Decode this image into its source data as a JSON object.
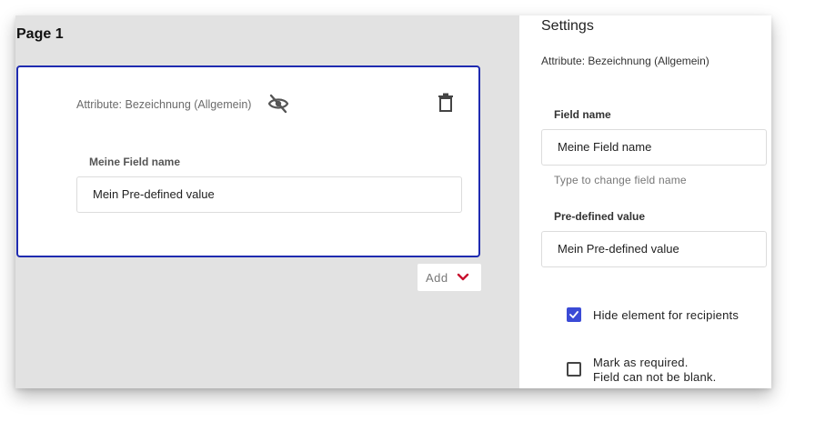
{
  "canvas": {
    "page_title": "Page 1",
    "card": {
      "attribute_label": "Attribute: Bezeichnung (Allgemein)",
      "field_label": "Meine Field name",
      "field_value": "Mein Pre-defined value",
      "hidden_icon": "eye-off-icon",
      "delete_icon": "trash-icon"
    },
    "add_button": {
      "label": "Add",
      "icon": "chevron-down-icon"
    }
  },
  "settings": {
    "title": "Settings",
    "attribute": "Attribute: Bezeichnung (Allgemein)",
    "field_name": {
      "label": "Field name",
      "value": "Meine Field name",
      "hint": "Type to change field name"
    },
    "predefined_value": {
      "label": "Pre-defined value",
      "value": "Mein Pre-defined value"
    },
    "options": [
      {
        "label_line1": "Hide element for recipients",
        "label_line2": "",
        "checked": true
      },
      {
        "label_line1": "Mark as required.",
        "label_line2": "Field can not be blank.",
        "checked": false
      }
    ]
  },
  "colors": {
    "accent": "#1f2bb0",
    "checkbox": "#3b4bd6",
    "chevron": "#c8102e",
    "canvas_bg": "#e2e2e2"
  }
}
